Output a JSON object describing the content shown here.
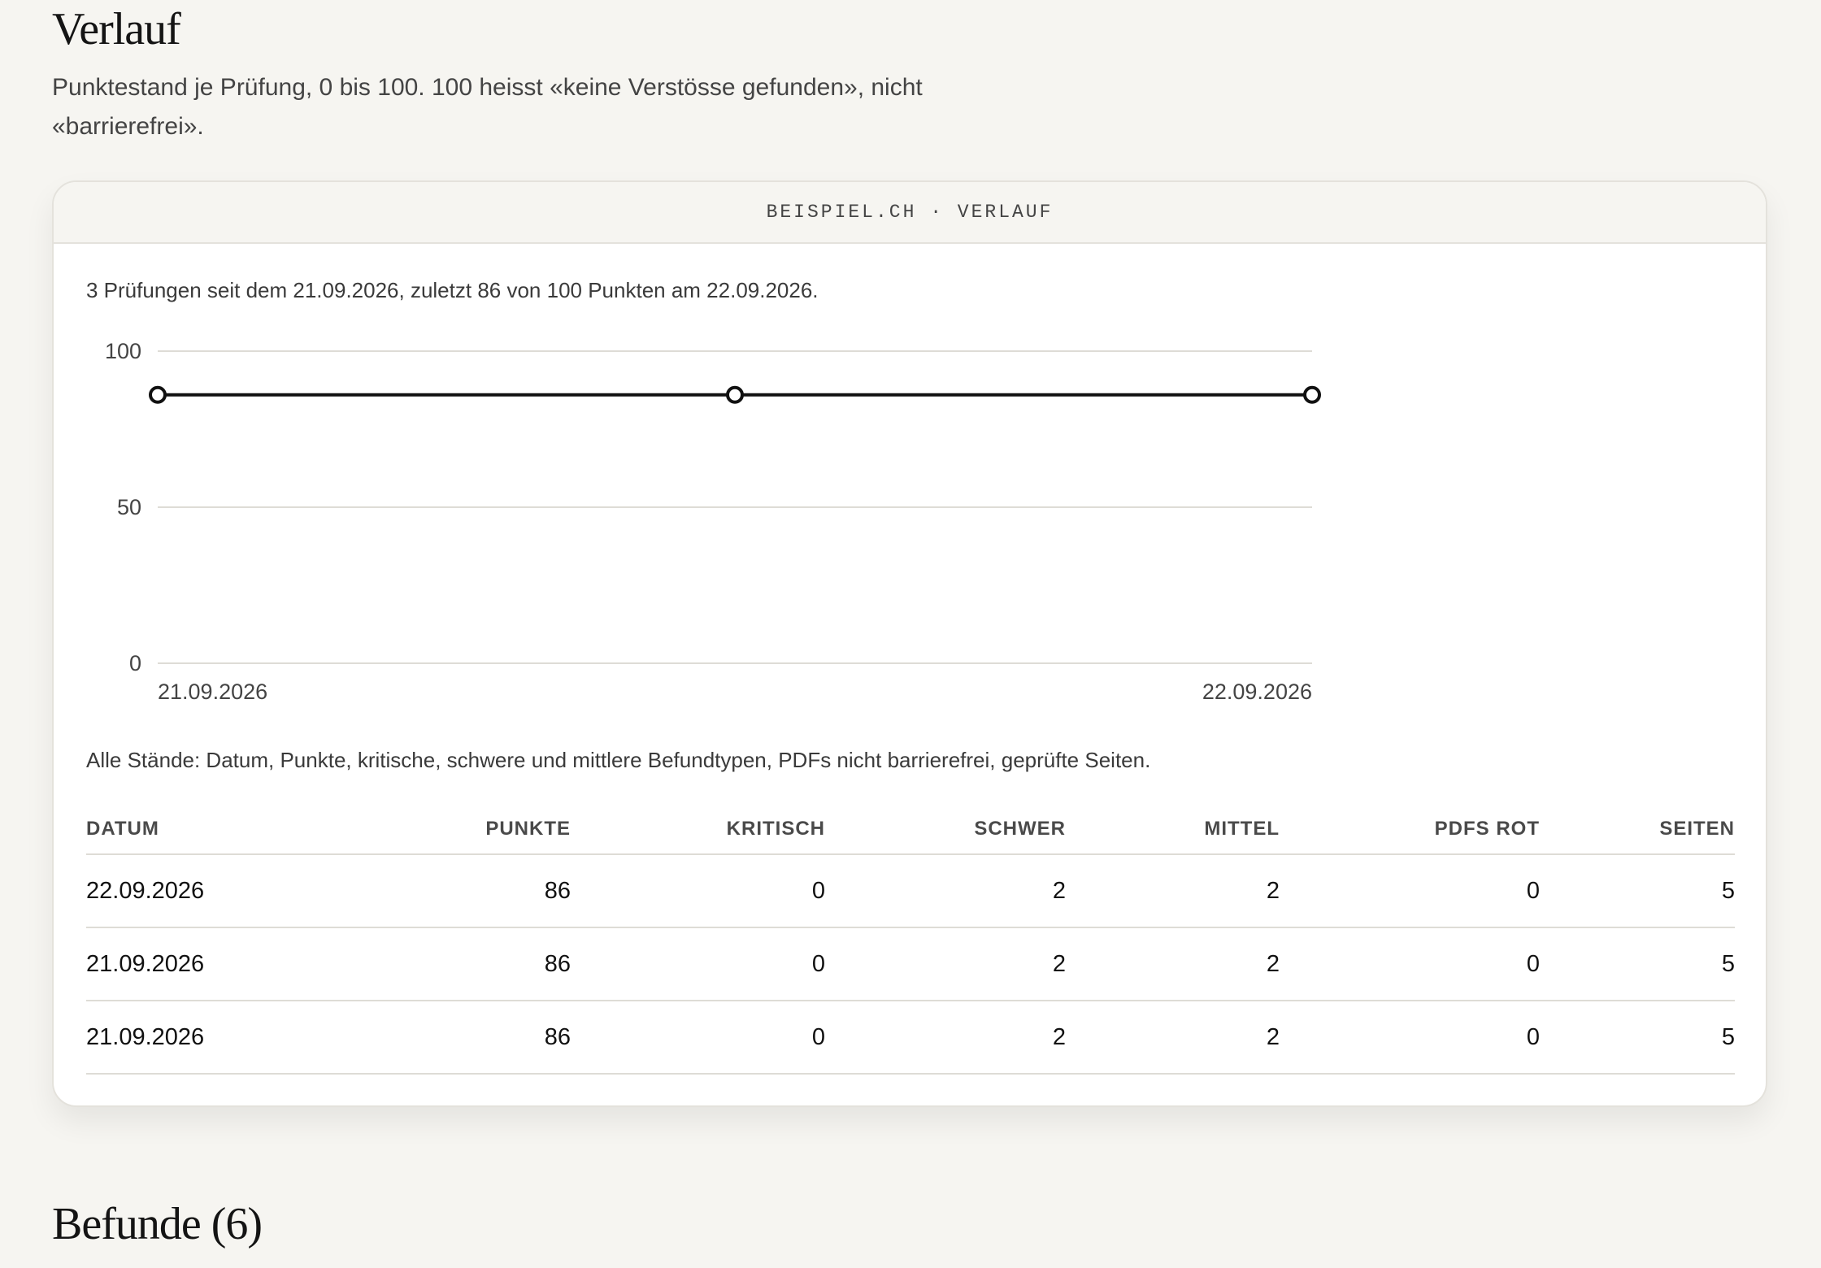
{
  "verlauf": {
    "title": "Verlauf",
    "intro": "Punktestand je Prüfung, 0 bis 100. 100 heisst «keine Verstösse gefunden», nicht «barrierefrei»."
  },
  "card": {
    "header": "BEISPIEL.CH · VERLAUF",
    "summary": "3 Prüfungen seit dem 21.09.2026, zuletzt 86 von 100 Punkten am 22.09.2026.",
    "table_note": "Alle Stände: Datum, Punkte, kritische, schwere und mittlere Befundtypen, PDFs nicht barrierefrei, geprüfte Seiten."
  },
  "chart_data": {
    "type": "line",
    "title": "",
    "xlabel": "",
    "ylabel": "",
    "ylim": [
      0,
      100
    ],
    "y_ticks": [
      "100",
      "50",
      "0"
    ],
    "x_tick_labels": [
      "21.09.2026",
      "22.09.2026"
    ],
    "x": [
      "21.09.2026",
      "21.09.2026",
      "22.09.2026"
    ],
    "values": [
      86,
      86,
      86
    ],
    "grid": true,
    "legend": "none",
    "line_color": "#111111"
  },
  "table": {
    "headers": [
      "DATUM",
      "PUNKTE",
      "KRITISCH",
      "SCHWER",
      "MITTEL",
      "PDFS ROT",
      "SEITEN"
    ],
    "rows": [
      [
        "22.09.2026",
        "86",
        "0",
        "2",
        "2",
        "0",
        "5"
      ],
      [
        "21.09.2026",
        "86",
        "0",
        "2",
        "2",
        "0",
        "5"
      ],
      [
        "21.09.2026",
        "86",
        "0",
        "2",
        "2",
        "0",
        "5"
      ]
    ]
  },
  "befunde": {
    "title": "Befunde (6)"
  }
}
